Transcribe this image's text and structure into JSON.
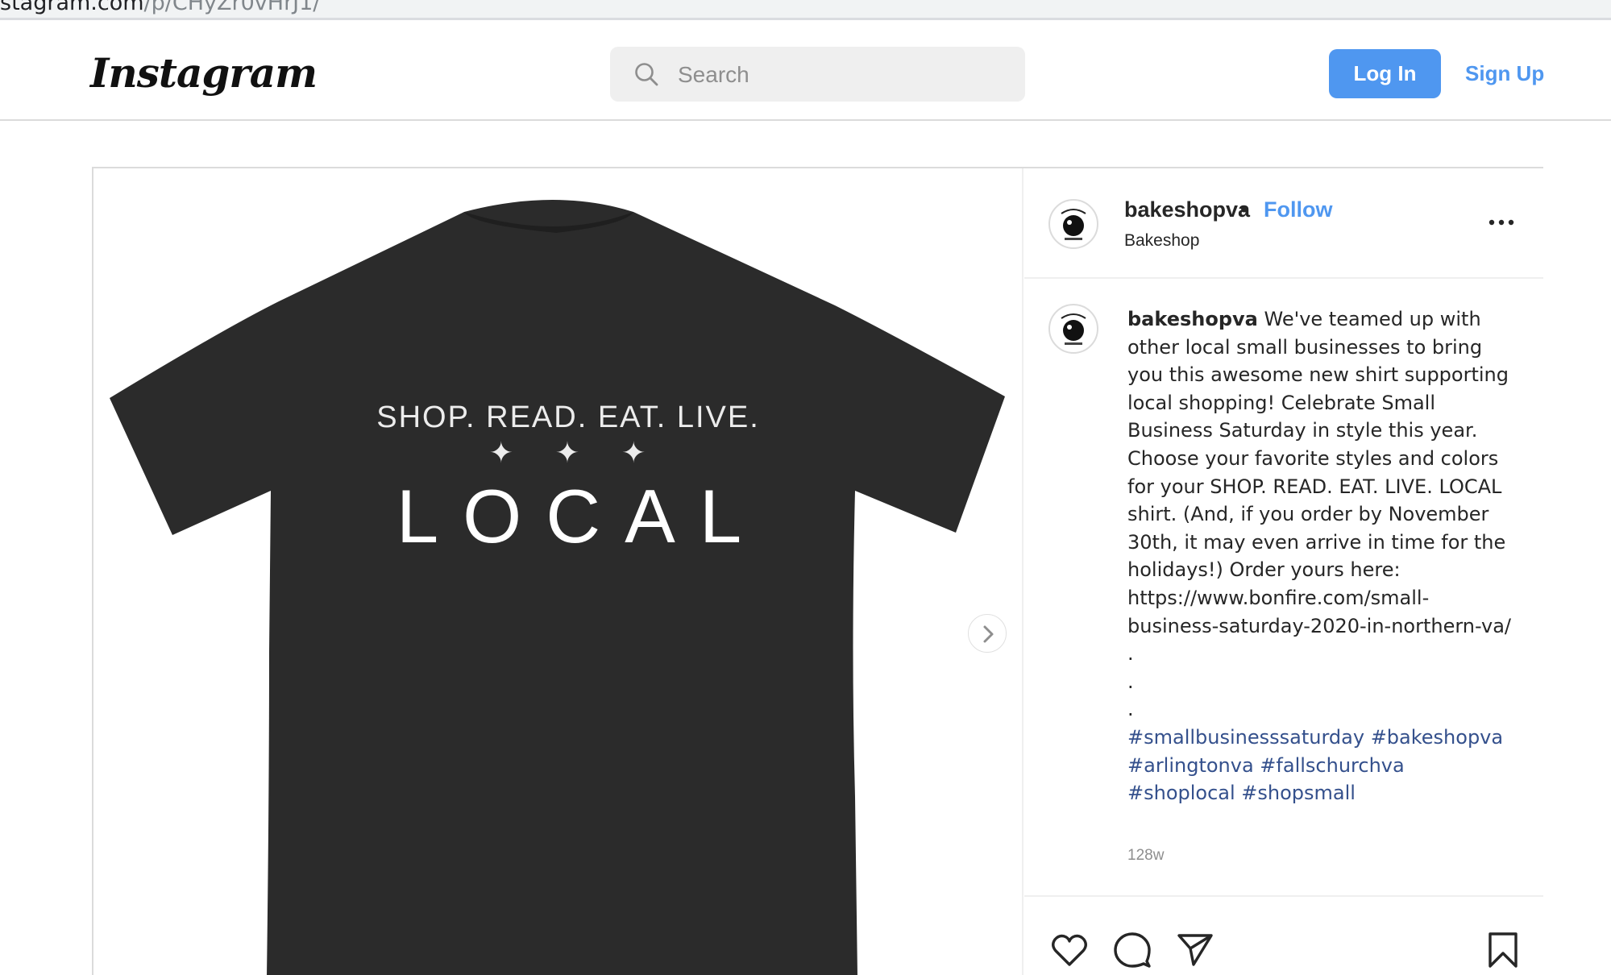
{
  "browser": {
    "url_visible": "stagram.com",
    "url_dim": "/p/CHyZr0vHrJ1/"
  },
  "header": {
    "logo": "Instagram",
    "search_placeholder": "Search",
    "login_label": "Log In",
    "signup_label": "Sign Up",
    "brand_color": "#4f97f0"
  },
  "post": {
    "image": {
      "line1": "SHOP. READ. EAT. LIVE.",
      "stars": "✦✦✦",
      "line2": "LOCAL",
      "shirt_color": "#2b2b2b"
    },
    "author": {
      "username": "bakeshopva",
      "separator": "•",
      "follow_label": "Follow",
      "display_name": "Bakeshop"
    },
    "caption": {
      "username": "bakeshopva",
      "text": "We've teamed up with other local small businesses to bring you this awesome new shirt supporting local shopping! Celebrate Small Business Saturday in style this year. Choose your favorite styles and colors for your SHOP. READ. EAT. LIVE. LOCAL shirt. (And, if you order by November 30th, it may even arrive in time for the holidays!) Order yours here: https://www.bonfire.com/small-business-saturday-2020-in-northern-va/",
      "dot1": ".",
      "dot2": ".",
      "dot3": ".",
      "hashtags": "#smallbusinesssaturday #bakeshopva #arlingtonva #fallschurchva #shoplocal #shopsmall"
    },
    "timestamp": "128w",
    "icons": [
      "heart-icon",
      "comment-icon",
      "share-icon",
      "bookmark-icon"
    ]
  }
}
